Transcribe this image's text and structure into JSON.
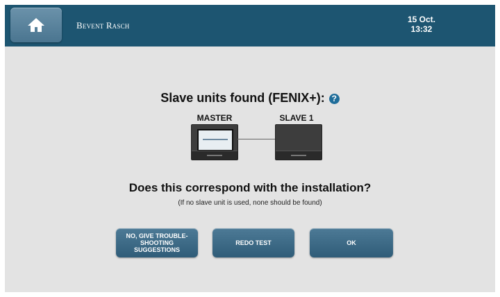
{
  "header": {
    "brand": "Bevent Rasch",
    "date": "15 Oct.",
    "time": "13:32",
    "home_icon": "home-icon"
  },
  "main": {
    "heading": "Slave units found (FENIX+):",
    "help_icon": "question-mark-icon",
    "units": [
      {
        "label": "MASTER"
      },
      {
        "label": "SLAVE 1"
      }
    ],
    "question": "Does this correspond with the installation?",
    "note": "(If no slave unit is used, none should be found)"
  },
  "buttons": {
    "troubleshoot_label": "NO, GIVE TROUBLE-SHOOTING SUGGESTIONS",
    "redo_label": "REDO TEST",
    "ok_label": "OK"
  },
  "colors": {
    "header_bg": "#1d5571",
    "page_bg": "#e3e3e3",
    "button_bg": "#3a6784",
    "help_icon": "#1f6d9a"
  }
}
